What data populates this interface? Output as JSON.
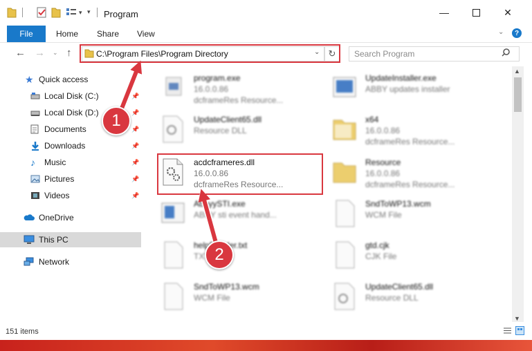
{
  "window": {
    "title": "Program"
  },
  "ribbon": {
    "tabs": [
      "File",
      "Home",
      "Share",
      "View"
    ],
    "help": "?"
  },
  "address": {
    "path": "C:\\Program Files\\Program Directory"
  },
  "search": {
    "placeholder": "Search Program"
  },
  "nav": {
    "items": [
      {
        "label": "Quick access",
        "icon": "star-icon",
        "pinned": false
      },
      {
        "label": "Local Disk (C:)",
        "icon": "drive-icon",
        "pinned": true
      },
      {
        "label": "Local Disk (D:)",
        "icon": "drive-icon",
        "pinned": true
      },
      {
        "label": "Documents",
        "icon": "documents-icon",
        "pinned": true
      },
      {
        "label": "Downloads",
        "icon": "download-icon",
        "pinned": true
      },
      {
        "label": "Music",
        "icon": "music-icon",
        "pinned": true
      },
      {
        "label": "Pictures",
        "icon": "pictures-icon",
        "pinned": true
      },
      {
        "label": "Videos",
        "icon": "videos-icon",
        "pinned": true
      },
      {
        "label": "OneDrive",
        "icon": "cloud-icon",
        "pinned": false
      },
      {
        "label": "This PC",
        "icon": "pc-icon",
        "pinned": false
      },
      {
        "label": "Network",
        "icon": "network-icon",
        "pinned": false
      }
    ]
  },
  "files": [
    {
      "name": "program.exe",
      "line2": "16.0.0.86",
      "line3": "dcframeRes Resource...",
      "icon": "exe-icon"
    },
    {
      "name": "UpdateInstaller.exe",
      "line2": "ABBY updates installer",
      "line3": "",
      "icon": "installer-icon"
    },
    {
      "name": "UpdateClient65.dll",
      "line2": "Resource DLL",
      "line3": "",
      "icon": "dll-icon"
    },
    {
      "name": "x64",
      "line2": "16.0.0.86",
      "line3": "dcframeRes Resource...",
      "icon": "folder-icon"
    },
    {
      "name": "acdcframeres.dll",
      "line2": "16.0.0.86",
      "line3": "dcframeRes Resource...",
      "icon": "dll-icon"
    },
    {
      "name": "Resource",
      "line2": "16.0.0.86",
      "line3": "dcframeRes Resource...",
      "icon": "folder-icon"
    },
    {
      "name": "AbbyySTI.exe",
      "line2": "ABBY sti event hand...",
      "line3": "",
      "icon": "exe-icon"
    },
    {
      "name": "SndToWP13.wcm",
      "line2": "WCM File",
      "line3": "",
      "icon": "file-icon"
    },
    {
      "name": "helpReader.txt",
      "line2": "TXT File",
      "line3": "",
      "icon": "file-icon"
    },
    {
      "name": "gtd.cjk",
      "line2": "CJK File",
      "line3": "",
      "icon": "file-icon"
    },
    {
      "name": "SndToWP13.wcm",
      "line2": "WCM File",
      "line3": "",
      "icon": "file-icon"
    },
    {
      "name": "UpdateClient65.dll",
      "line2": "Resource DLL",
      "line3": "",
      "icon": "dll-icon"
    }
  ],
  "status": {
    "items": "151 items"
  },
  "annotations": {
    "step1": "1",
    "step2": "2"
  },
  "colors": {
    "accent": "#1979ca",
    "highlight": "#d9373f"
  }
}
